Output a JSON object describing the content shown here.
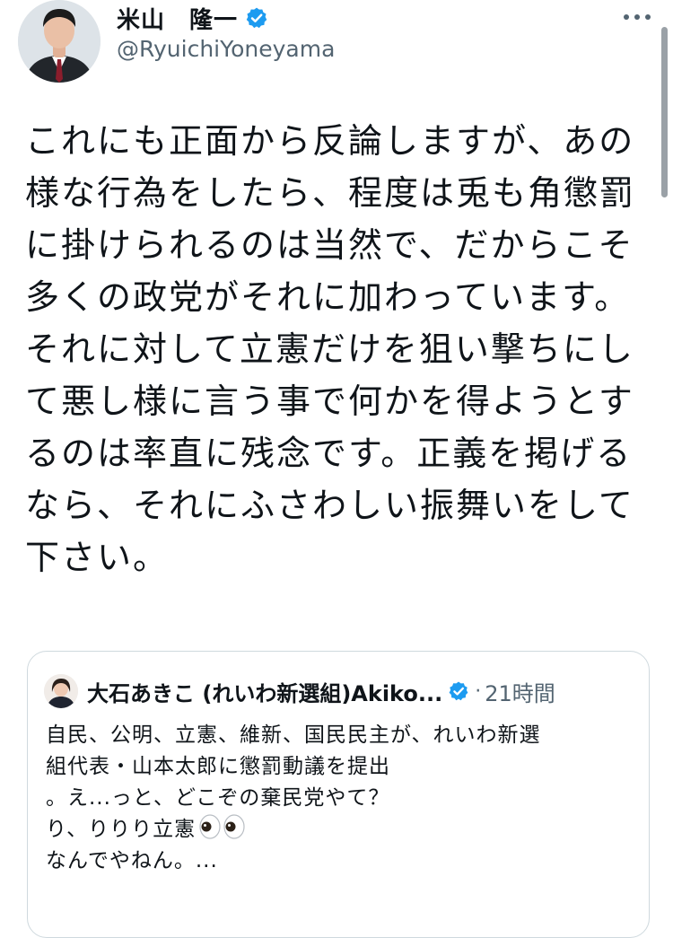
{
  "author": {
    "name": "米山　隆一",
    "handle": "@RyuichiYoneyama",
    "avatar_icon": "profile-photo-man-suit",
    "verified_icon": "verified-badge-icon",
    "more_icon": "more-options-icon"
  },
  "tweet": {
    "text": "これにも正面から反論しますが、あの\n様な行為をしたら、程度は兎も角懲罰\nに掛けられるのは当然で、だからこそ\n多くの政党がそれに加わっています。\nそれに対して立憲だけを狙い撃ちにし\nて悪し様に言う事で何かを得ようとす\nるのは率直に残念です。正義を掲げる\nなら、それにふさわしい振舞いをして\n下さい。"
  },
  "quote": {
    "name": "大石あきこ (れいわ新選組)Akiko...",
    "time_separator": "·",
    "time": "21時間",
    "avatar_icon": "profile-photo-woman",
    "lines": [
      "自民、公明、立憲、維新、国民民主が、れいわ新選",
      "組代表・山本太郎に懲罰動議を提出",
      "。え...っと、どこぞの棄民党やて？",
      "り、りりり立憲",
      "なんでやねん。..."
    ],
    "emoji_icon": "eyes-emoji-icon"
  },
  "colors": {
    "text": "#0f1419",
    "secondary": "#536471",
    "verified": "#1d9bf0",
    "border": "#cfd9de"
  }
}
